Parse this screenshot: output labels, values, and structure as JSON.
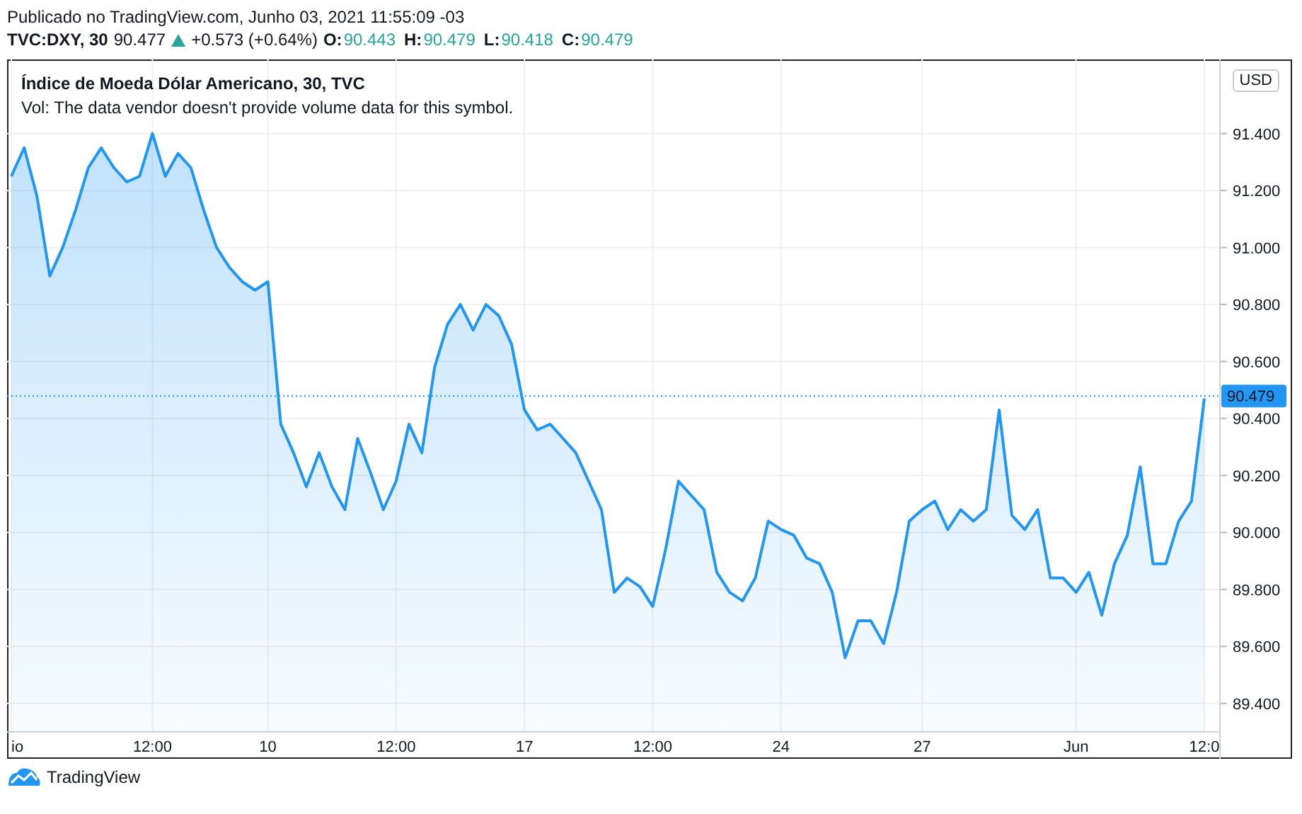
{
  "header": {
    "published": "Publicado no TradingView.com, Junho 03, 2021 11:55:09 -03",
    "symbol": "TVC:DXY, 30",
    "last": "90.477",
    "change": "+0.573 (+0.64%)",
    "ohlc": [
      {
        "label": "O:",
        "value": "90.443"
      },
      {
        "label": "H:",
        "value": "90.479"
      },
      {
        "label": "L:",
        "value": "90.418"
      },
      {
        "label": "C:",
        "value": "90.479"
      }
    ]
  },
  "chart": {
    "title": "Índice de Moeda Dólar Americano, 30, TVC",
    "volume_note": "Vol: The data vendor doesn't provide volume data for this symbol.",
    "currency": "USD",
    "price_label": "90.479",
    "chart_data": {
      "type": "area",
      "categories": [
        "io",
        null,
        null,
        null,
        null,
        null,
        null,
        null,
        null,
        null,
        null,
        "12:00",
        null,
        null,
        null,
        null,
        null,
        null,
        null,
        null,
        "10",
        null,
        null,
        null,
        null,
        null,
        null,
        null,
        null,
        null,
        "12:00",
        null,
        null,
        null,
        null,
        null,
        null,
        null,
        null,
        null,
        "17",
        null,
        null,
        null,
        null,
        null,
        null,
        null,
        null,
        null,
        "12:00",
        null,
        null,
        null,
        null,
        null,
        null,
        null,
        null,
        null,
        "24",
        null,
        null,
        null,
        null,
        null,
        null,
        null,
        null,
        null,
        null,
        "27",
        null,
        null,
        null,
        null,
        null,
        null,
        null,
        null,
        null,
        null,
        null,
        "Jun",
        null,
        null,
        null,
        null,
        null,
        null,
        null,
        null,
        null,
        "12:0"
      ],
      "series": [
        {
          "color": "#2196f3",
          "values": [
            91.25,
            91.35,
            91.18,
            90.9,
            91.0,
            91.13,
            91.28,
            91.35,
            91.28,
            91.23,
            91.25,
            91.4,
            91.25,
            91.33,
            91.28,
            91.13,
            91.0,
            90.93,
            90.88,
            90.85,
            90.88,
            90.38,
            90.28,
            90.16,
            90.28,
            90.16,
            90.08,
            90.33,
            90.21,
            90.08,
            90.18,
            90.38,
            90.28,
            90.58,
            90.73,
            90.8,
            90.71,
            90.8,
            90.76,
            90.66,
            90.43,
            90.36,
            90.38,
            90.33,
            90.28,
            90.18,
            90.08,
            89.79,
            89.84,
            89.81,
            89.74,
            89.94,
            90.18,
            90.13,
            90.08,
            89.86,
            89.79,
            89.76,
            89.84,
            90.04,
            90.01,
            89.99,
            89.91,
            89.89,
            89.79,
            89.56,
            89.69,
            89.69,
            89.61,
            89.79,
            90.04,
            90.08,
            90.11,
            90.01,
            90.08,
            90.04,
            90.08,
            90.43,
            90.06,
            90.01,
            90.08,
            89.84,
            89.84,
            89.79,
            89.86,
            89.71,
            89.89,
            89.99,
            90.23,
            89.89,
            89.89,
            90.04,
            90.11,
            90.47
          ]
        }
      ],
      "ylim": [
        89.3,
        91.66
      ],
      "grid": true,
      "ref_lines": [
        {
          "axis": "y",
          "value": 90.479,
          "color": "#2196f3"
        }
      ],
      "yticks": [
        {
          "value": 89.4,
          "label": "89.400"
        },
        {
          "value": 89.6,
          "label": "89.600"
        },
        {
          "value": 89.8,
          "label": "89.800"
        },
        {
          "value": 90.0,
          "label": "90.000"
        },
        {
          "value": 90.2,
          "label": "90.200"
        },
        {
          "value": 90.4,
          "label": "90.400"
        },
        {
          "value": 90.6,
          "label": "90.600"
        },
        {
          "value": 90.8,
          "label": "90.800"
        },
        {
          "value": 91.0,
          "label": "91.000"
        },
        {
          "value": 91.2,
          "label": "91.200"
        },
        {
          "value": 91.4,
          "label": "91.400"
        }
      ]
    }
  },
  "footer": {
    "brand": "TradingView"
  }
}
